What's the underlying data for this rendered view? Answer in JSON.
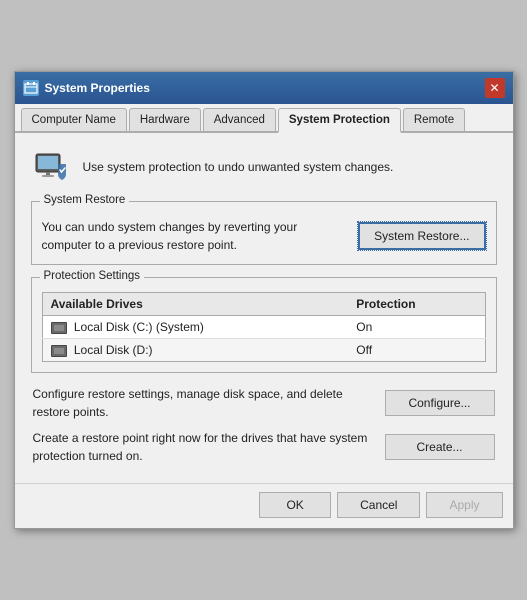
{
  "window": {
    "title": "System Properties",
    "title_icon": "⚙",
    "close_label": "✕"
  },
  "tabs": [
    {
      "id": "computer-name",
      "label": "Computer Name",
      "active": false
    },
    {
      "id": "hardware",
      "label": "Hardware",
      "active": false
    },
    {
      "id": "advanced",
      "label": "Advanced",
      "active": false
    },
    {
      "id": "system-protection",
      "label": "System Protection",
      "active": true
    },
    {
      "id": "remote",
      "label": "Remote",
      "active": false
    }
  ],
  "info_banner": {
    "text": "Use system protection to undo unwanted system changes."
  },
  "system_restore_section": {
    "label": "System Restore",
    "description": "You can undo system changes by reverting\nyour computer to a previous restore point.",
    "button_label": "System Restore..."
  },
  "protection_settings_section": {
    "label": "Protection Settings",
    "columns": [
      "Available Drives",
      "Protection"
    ],
    "drives": [
      {
        "icon": "hdd",
        "name": "Local Disk (C:) (System)",
        "protection": "On"
      },
      {
        "icon": "hdd",
        "name": "Local Disk (D:)",
        "protection": "Off"
      }
    ]
  },
  "configure_row": {
    "text": "Configure restore settings, manage disk space,\nand delete restore points.",
    "button_label": "Configure..."
  },
  "create_row": {
    "text": "Create a restore point right now for the drives that\nhave system protection turned on.",
    "button_label": "Create..."
  },
  "dialog_buttons": {
    "ok": "OK",
    "cancel": "Cancel",
    "apply": "Apply"
  }
}
